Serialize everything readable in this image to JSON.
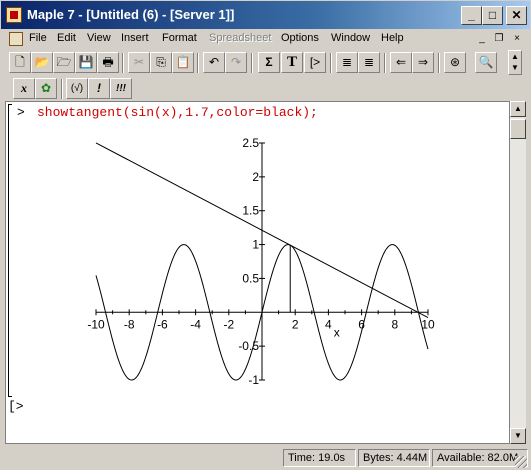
{
  "window": {
    "title": "Maple 7  - [Untitled (6) - [Server 1]]",
    "minimize_glyph": "_",
    "maximize_glyph": "□",
    "close_glyph": "✕"
  },
  "menu": {
    "items": [
      "File",
      "Edit",
      "View",
      "Insert",
      "Format",
      "Spreadsheet",
      "Options",
      "Window",
      "Help"
    ],
    "disabled_item": "Spreadsheet",
    "mdi": {
      "minimize": "_",
      "restore": "❐",
      "close": "×"
    }
  },
  "toolbar": {
    "sum_label": "Σ",
    "text_label": "T",
    "exec_label": "[>",
    "math_x_label": "x",
    "paren_label": "(√)",
    "exclaim_label": "!",
    "triple_exclaim_label": "!!!"
  },
  "worksheet": {
    "prompt": ">",
    "command": "showtangent(sin(x),1.7,color=black);",
    "empty_prompt": "[>"
  },
  "chart_data": {
    "type": "line",
    "title": "",
    "xlabel": "x",
    "ylabel": "",
    "xlim": [
      -10,
      10
    ],
    "ylim": [
      -1,
      2.5
    ],
    "x_ticks": [
      -10,
      -8,
      -6,
      -4,
      -2,
      2,
      4,
      6,
      8,
      10
    ],
    "x_tick_labels": [
      "-10",
      "-8",
      "-6",
      "-4",
      "-2",
      "2",
      "4",
      "6",
      "8",
      "10"
    ],
    "y_ticks": [
      2.5,
      2,
      1.5,
      1,
      0.5,
      -0.5,
      -1
    ],
    "y_tick_labels": [
      "2.5",
      "2",
      "1.5",
      "1",
      "0.5",
      "-0.5",
      "-1"
    ],
    "series": [
      {
        "function": "sin(x)",
        "x_range": [
          -10,
          10
        ]
      },
      {
        "function": "tangent at x=1.7",
        "point": [
          1.7,
          0.992
        ],
        "slope": -0.129,
        "x_range": [
          -10,
          10
        ]
      }
    ],
    "vertical_line": {
      "x": 1.7,
      "y_from": 0,
      "y_to": 0.992
    },
    "color": "#000000",
    "grid": false,
    "legend": "none"
  },
  "status": {
    "time": "Time:  19.0s",
    "bytes": "Bytes: 4.44M",
    "available": "Available: 82.0M"
  }
}
